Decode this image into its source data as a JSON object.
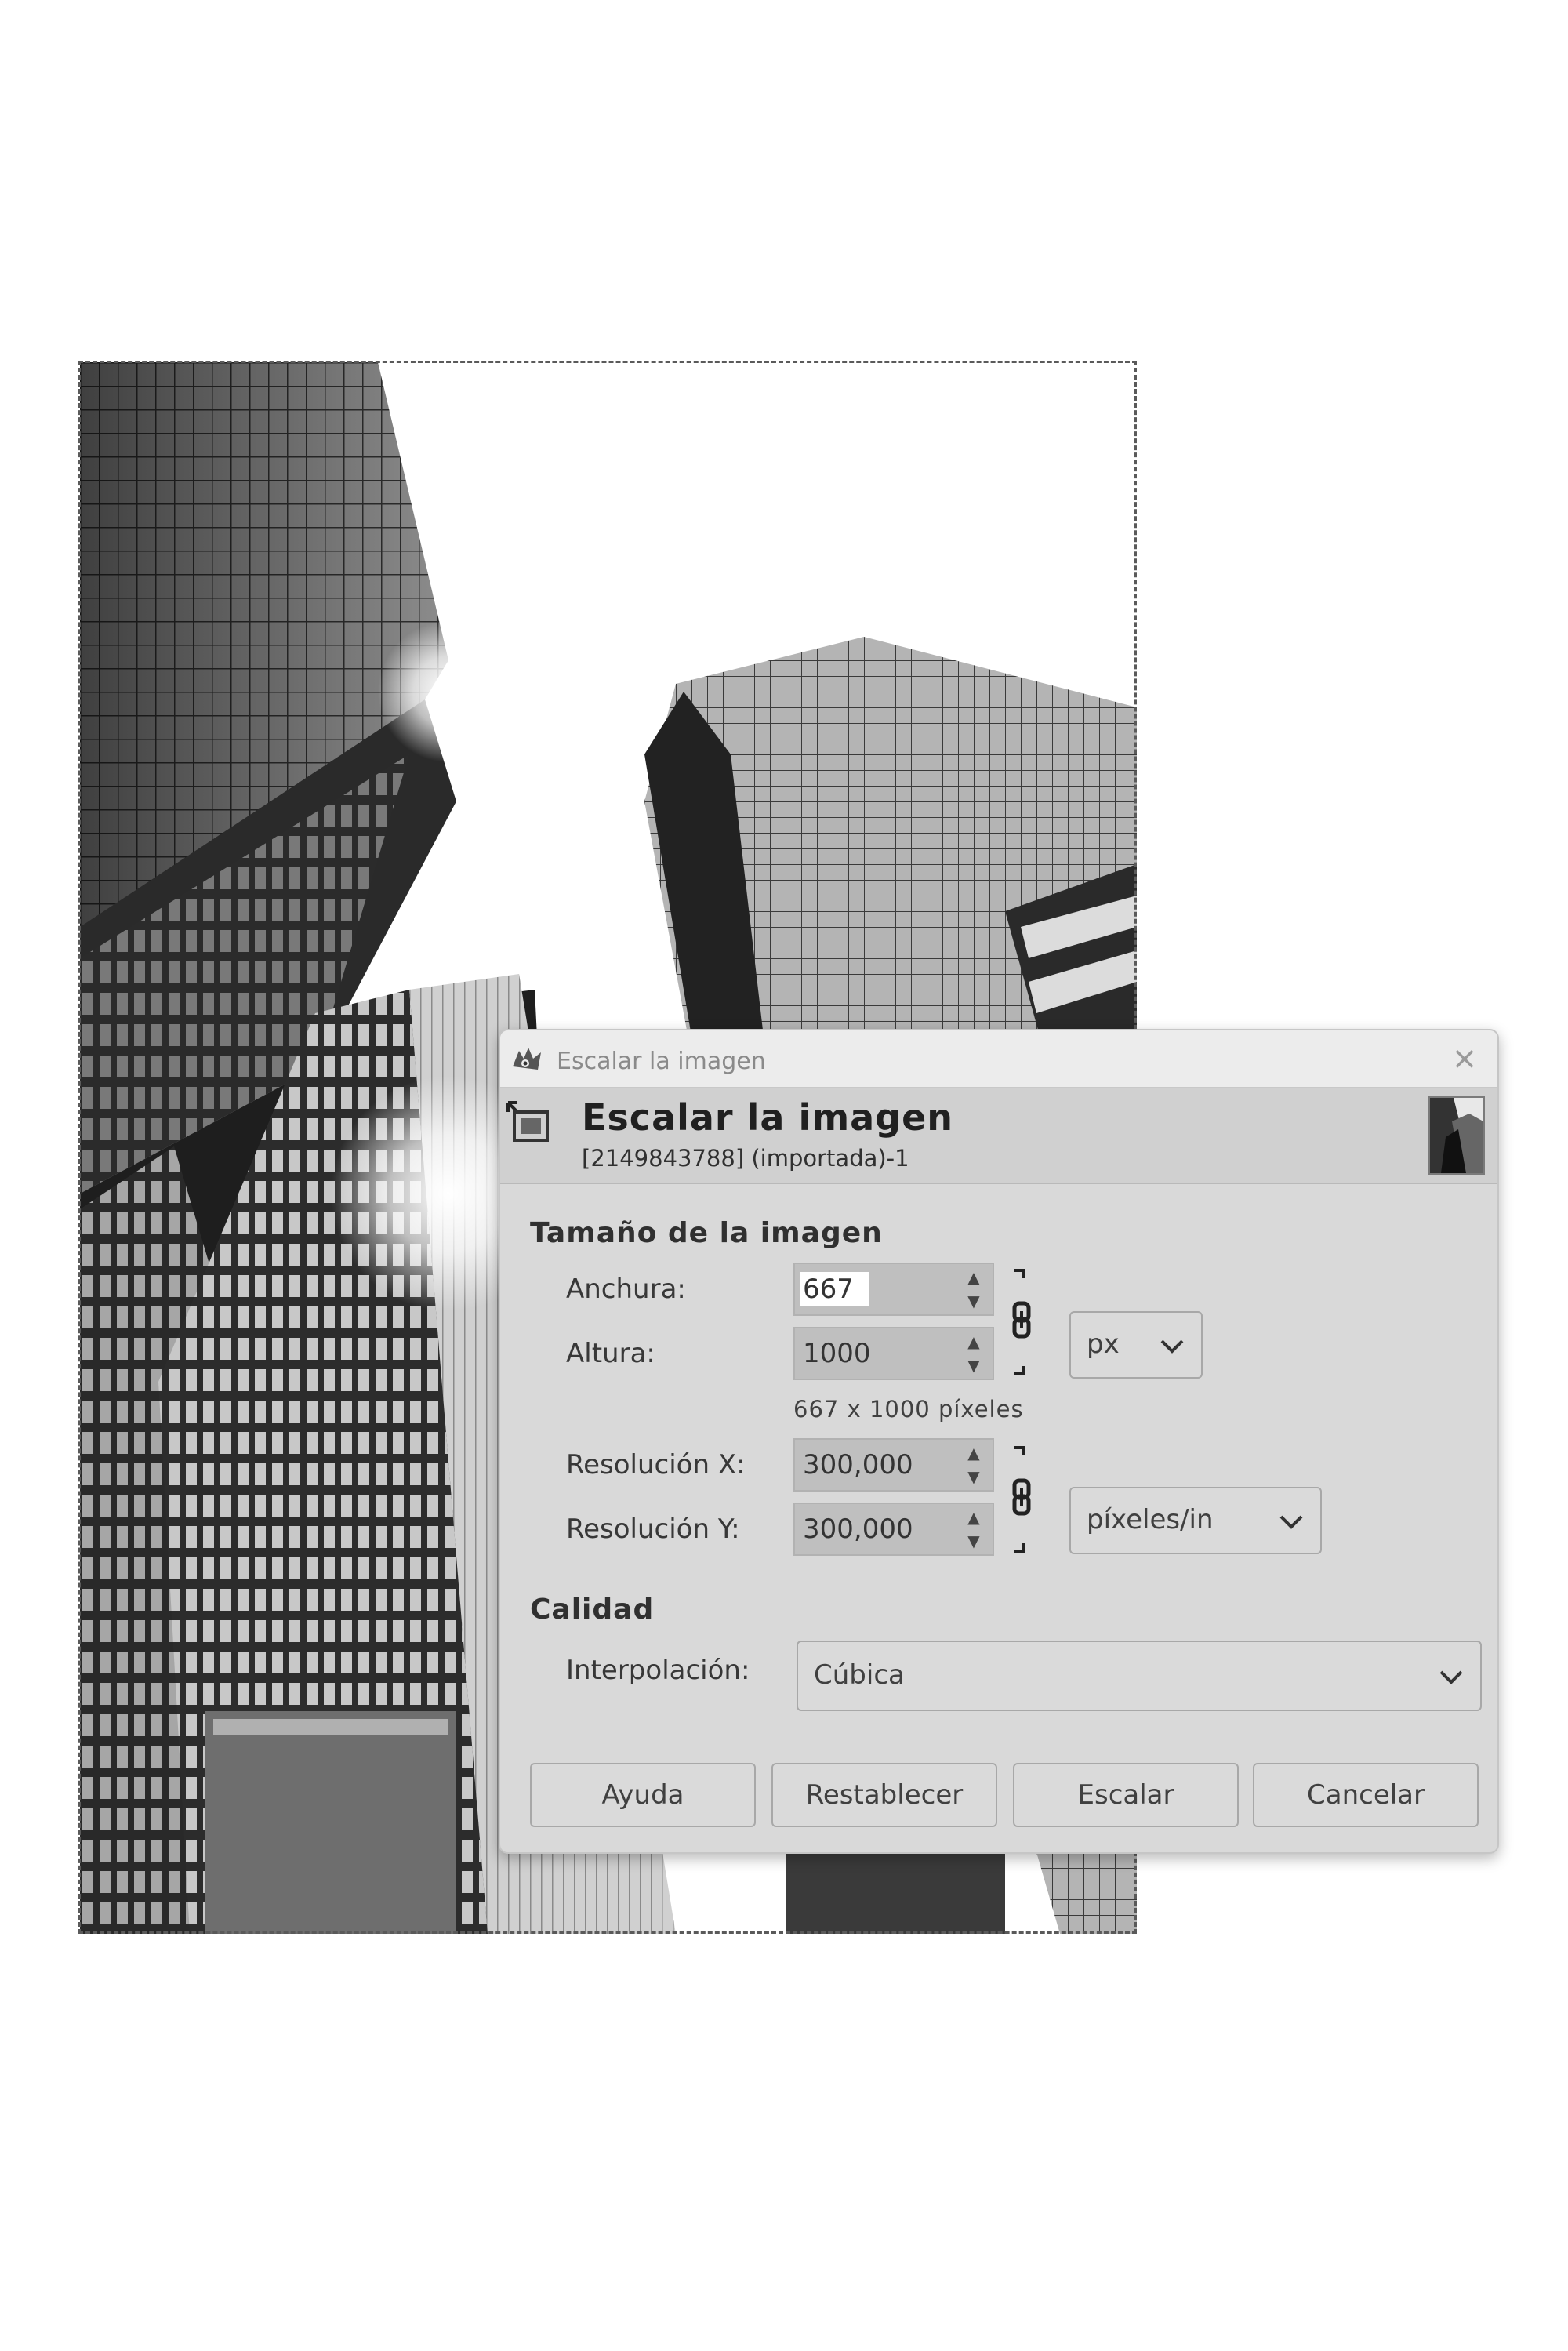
{
  "window": {
    "title": "Escalar la imagen",
    "close_label": "×"
  },
  "header": {
    "title": "Escalar la imagen",
    "subtitle": "[2149843788] (importada)-1"
  },
  "image_size": {
    "section_title": "Tamaño de la imagen",
    "width_label": "Anchura:",
    "width_value": "667",
    "height_label": "Altura:",
    "height_value": "1000",
    "size_info": "667 x 1000 píxeles",
    "unit": "px",
    "res_x_label": "Resolución X:",
    "res_x_value": "300,000",
    "res_y_label": "Resolución Y:",
    "res_y_value": "300,000",
    "res_unit": "píxeles/in"
  },
  "quality": {
    "section_title": "Calidad",
    "interpolation_label": "Interpolación:",
    "interpolation_value": "Cúbica"
  },
  "buttons": {
    "help": "Ayuda",
    "reset": "Restablecer",
    "scale": "Escalar",
    "cancel": "Cancelar"
  },
  "icons": [
    "gimp-wilber-icon",
    "scale-image-icon",
    "image-thumbnail",
    "chain-link-icon",
    "chevron-down-icon",
    "spin-up-icon",
    "spin-down-icon",
    "close-icon"
  ]
}
